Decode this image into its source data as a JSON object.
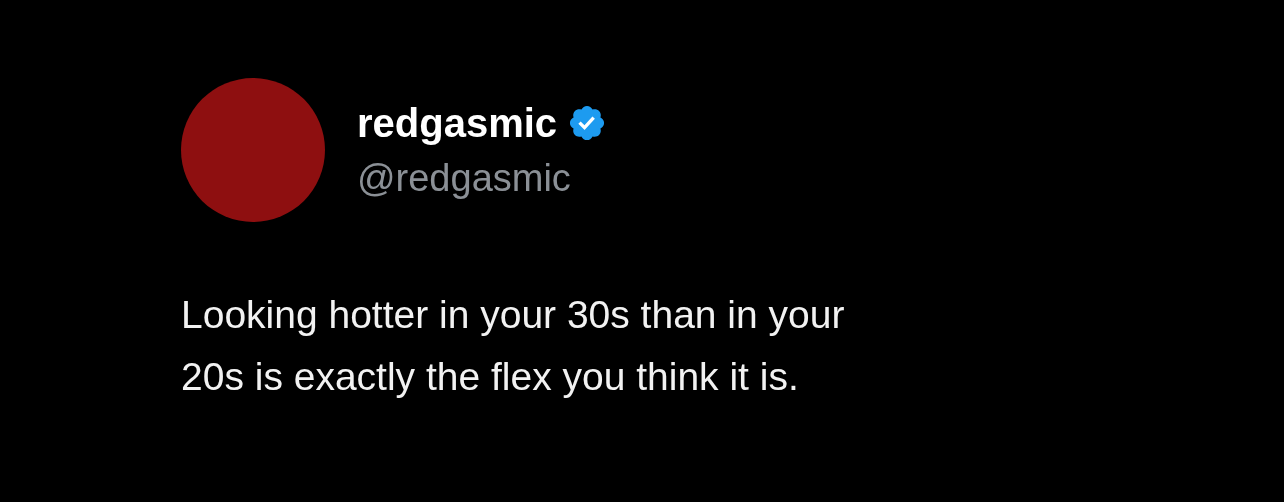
{
  "author": {
    "name": "redgasmic",
    "verified": true,
    "handle": "@redgasmic"
  },
  "tweet": {
    "text": "Looking hotter in your 30s than in your\n20s is exactly the flex you think it is."
  }
}
